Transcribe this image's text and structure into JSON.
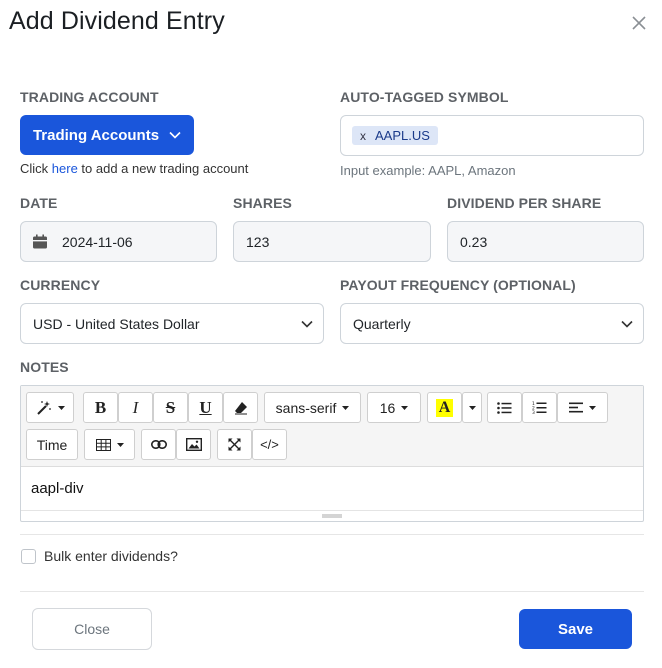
{
  "modal": {
    "title": "Add Dividend Entry"
  },
  "account": {
    "label": "TRADING ACCOUNT",
    "button": "Trading Accounts",
    "helper_prefix": "Click ",
    "helper_link": "here",
    "helper_suffix": " to add a new trading account"
  },
  "symbol": {
    "label": "AUTO-TAGGED SYMBOL",
    "tag_remove": "x",
    "tag": "AAPL.US",
    "example": "Input example: AAPL, Amazon"
  },
  "date": {
    "label": "DATE",
    "value": "2024-11-06"
  },
  "shares": {
    "label": "SHARES",
    "value": "123"
  },
  "dps": {
    "label": "DIVIDEND PER SHARE",
    "value": "0.23"
  },
  "currency": {
    "label": "CURRENCY",
    "value": "USD - United States Dollar"
  },
  "frequency": {
    "label": "PAYOUT FREQUENCY (OPTIONAL)",
    "value": "Quarterly"
  },
  "notes": {
    "label": "NOTES",
    "content": "aapl-div",
    "toolbar": {
      "font_family": "sans-serif",
      "font_size": "16",
      "time": "Time",
      "code": "</>"
    }
  },
  "bulk": {
    "label": "Bulk enter dividends?"
  },
  "footer": {
    "close": "Close",
    "save": "Save"
  },
  "colors": {
    "primary": "#1a56db",
    "highlight": "#ffff00"
  }
}
